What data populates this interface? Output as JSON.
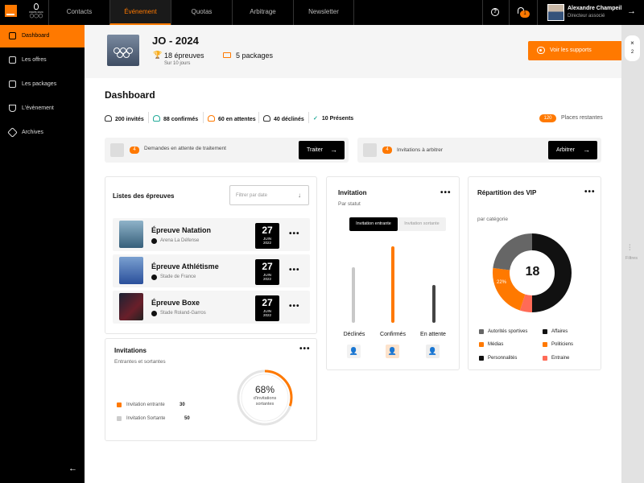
{
  "header": {
    "tabs": [
      {
        "label": "Contacts",
        "active": false
      },
      {
        "label": "Événement",
        "active": true
      },
      {
        "label": "Quotas",
        "active": false
      },
      {
        "label": "Arbitrage",
        "active": false
      },
      {
        "label": "Newsletter",
        "active": false
      }
    ],
    "notification_count": "1",
    "user": {
      "name": "Alexandre Champeil",
      "role": "Directeur associé"
    },
    "logo_text": "PARIS 2024"
  },
  "sidebar": {
    "items": [
      {
        "label": "Dashboard",
        "active": true,
        "icon": "dashboard-icon"
      },
      {
        "label": "Les offres",
        "active": false,
        "icon": "basket-icon"
      },
      {
        "label": "Les packages",
        "active": false,
        "icon": "ticket-icon"
      },
      {
        "label": "L'évènement",
        "active": false,
        "icon": "trophy-icon"
      },
      {
        "label": "Archives",
        "active": false,
        "icon": "archive-icon"
      }
    ]
  },
  "event": {
    "title": "JO - 2024",
    "epreuves": "18 épreuves",
    "period": "Sur 10 jours",
    "packages": "5 packages",
    "supports_button": "Voir les supports"
  },
  "dashboard": {
    "title": "Dashboard",
    "stats": [
      {
        "label": "200 invités"
      },
      {
        "label": "88 confirmés"
      },
      {
        "label": "60 en attentes"
      },
      {
        "label": "40 déclinés"
      },
      {
        "label": "10 Présents"
      }
    ],
    "places_count": "120",
    "places_label": "Places restantes"
  },
  "actions": [
    {
      "count": "4",
      "text": "Demandes en attente de traitement",
      "button": "Traiter"
    },
    {
      "count": "4",
      "text": "Invitations à arbitrer",
      "button": "Arbitrer"
    }
  ],
  "epreuves_card": {
    "title": "Listes des épreuves",
    "filter_placeholder": "Filtrer par date",
    "rows": [
      {
        "name": "Épreuve Natation",
        "venue": "Arena La Défense",
        "day": "27",
        "month": "JUIN",
        "year": "2022"
      },
      {
        "name": "Épreuve Athlétisme",
        "venue": "Stade de France",
        "day": "27",
        "month": "JUIN",
        "year": "2022"
      },
      {
        "name": "Épreuve Boxe",
        "venue": "Stade Roland-Garros",
        "day": "27",
        "month": "JUIN",
        "year": "2022"
      }
    ]
  },
  "invitations_card": {
    "title": "Invitations",
    "subtitle": "Entrantes et sortantes",
    "legend": [
      {
        "label": "Invitation entrante",
        "value": "30",
        "color": "#ff7900"
      },
      {
        "label": "Invitation Sortante",
        "value": "50",
        "color": "#cccccc"
      }
    ],
    "gauge_value": "68%",
    "gauge_label": "d'invitations sortantes",
    "gauge_fraction": 0.3
  },
  "invitation_status_card": {
    "title": "Invitation",
    "subtitle": "Par statut",
    "toggle": [
      "Invitation entrante",
      "Invitation sortante"
    ],
    "bars": [
      {
        "label": "Déclinés",
        "value": 40,
        "color": "#c8c8c8",
        "icon_color": "#f2f2f2"
      },
      {
        "label": "Confirmés",
        "value": 55,
        "color": "#ff7900",
        "icon_color": "#fde3cc"
      },
      {
        "label": "En attente",
        "value": 27,
        "color": "#444444",
        "icon_color": "#eeeeee"
      }
    ]
  },
  "vip_card": {
    "title": "Répartition des VIP",
    "subtitle": "par catégorie",
    "total": "18",
    "slice_label": "22%",
    "slices": [
      {
        "label": "Affaires",
        "value": 50,
        "color": "#111111"
      },
      {
        "label": "Entraine",
        "value": 5,
        "color": "#ff6b57"
      },
      {
        "label": "Médias",
        "value": 22,
        "color": "#ff7900"
      },
      {
        "label": "Autorités sportives",
        "value": 23,
        "color": "#666666"
      }
    ],
    "legend": [
      {
        "label": "Autorités sportives",
        "color": "#666666"
      },
      {
        "label": "Affaires",
        "color": "#111111"
      },
      {
        "label": "Médias",
        "color": "#ff7900"
      },
      {
        "label": "Politiciens",
        "color": "#ff7900"
      },
      {
        "label": "Personnalités",
        "color": "#111111"
      },
      {
        "label": "Entraine",
        "color": "#ff6b57"
      }
    ]
  },
  "rail": {
    "close_label": "×",
    "count": "2",
    "filter_label": "Filtres"
  }
}
